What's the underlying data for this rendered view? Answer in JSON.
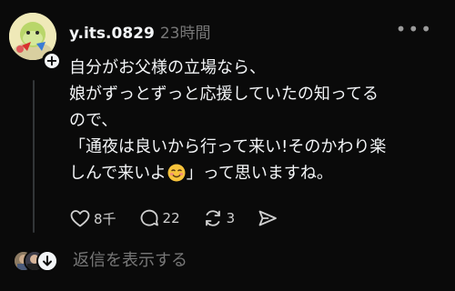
{
  "post": {
    "username": "y.its.0829",
    "timestamp": "23時間",
    "more_icon": "more-horizontal-icon",
    "body_lines": [
      "自分がお父様の立場なら、",
      "娘がずっとずっと応援していたの知ってる",
      "ので、",
      "「通夜は良いから行って来い!そのかわり楽",
      "しんで来いよ",
      "」って思いますね。"
    ],
    "emoji": "smiling-face-emoji",
    "actions": {
      "like_count": "8千",
      "comment_count": "22",
      "repost_count": "3"
    },
    "reply_link": "返信を表示する"
  },
  "colors": {
    "background": "#0a0a0a",
    "text": "#f3f5f7",
    "muted": "#777777"
  }
}
